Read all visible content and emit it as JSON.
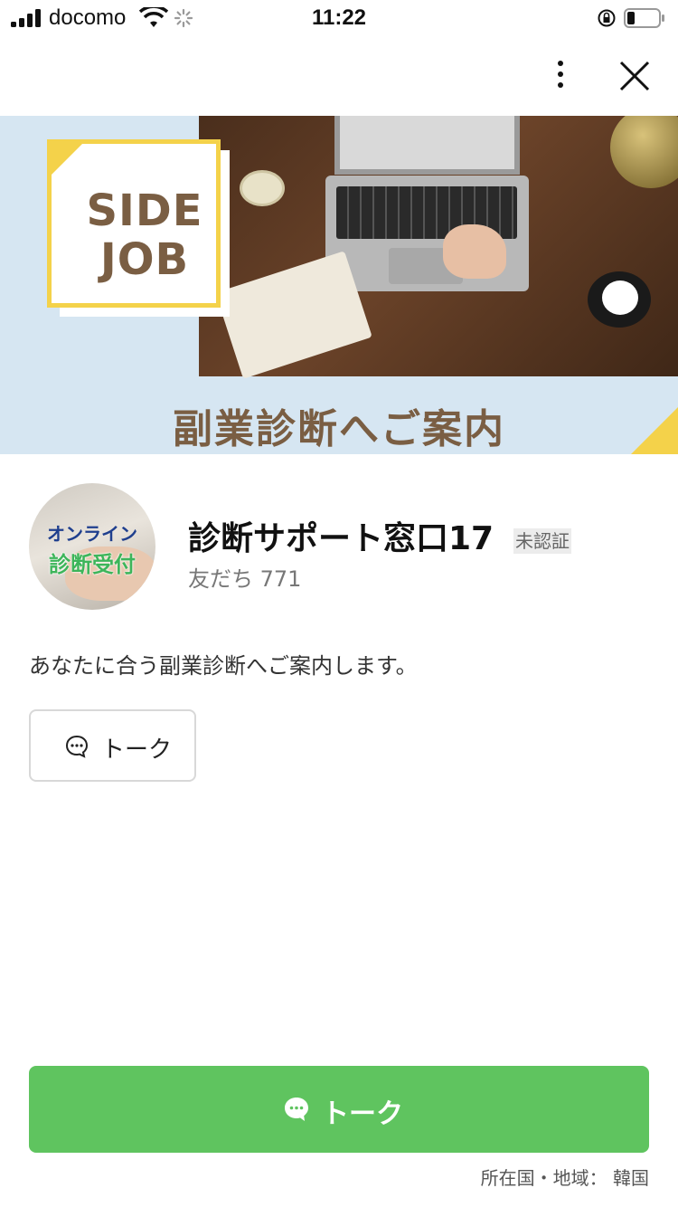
{
  "status_bar": {
    "carrier": "docomo",
    "time": "11:22"
  },
  "nav": {
    "more_icon": "more-vertical-icon",
    "close_icon": "close-icon"
  },
  "cover": {
    "badge_line1": "SIDE",
    "badge_line2": "JOB",
    "title": "副業診断へご案内"
  },
  "profile": {
    "avatar_line1": "オンライン",
    "avatar_line2": "診断受付",
    "name": "診断サポート窓口17",
    "badge": "未認証",
    "friends_label": "友だち",
    "friends_count": "771",
    "description": "あなたに合う副業診断へご案内します。"
  },
  "actions": {
    "talk_small_label": "トーク",
    "talk_large_label": "トーク",
    "talk_icon": "chat-bubble-icon"
  },
  "footer": {
    "region_label": "所在国・地域：",
    "region_value": "韓国"
  },
  "colors": {
    "line_green": "#5fc45f",
    "cover_bg": "#d6e6f2",
    "accent_yellow": "#f4d24a",
    "brown_text": "#7a5e43"
  }
}
